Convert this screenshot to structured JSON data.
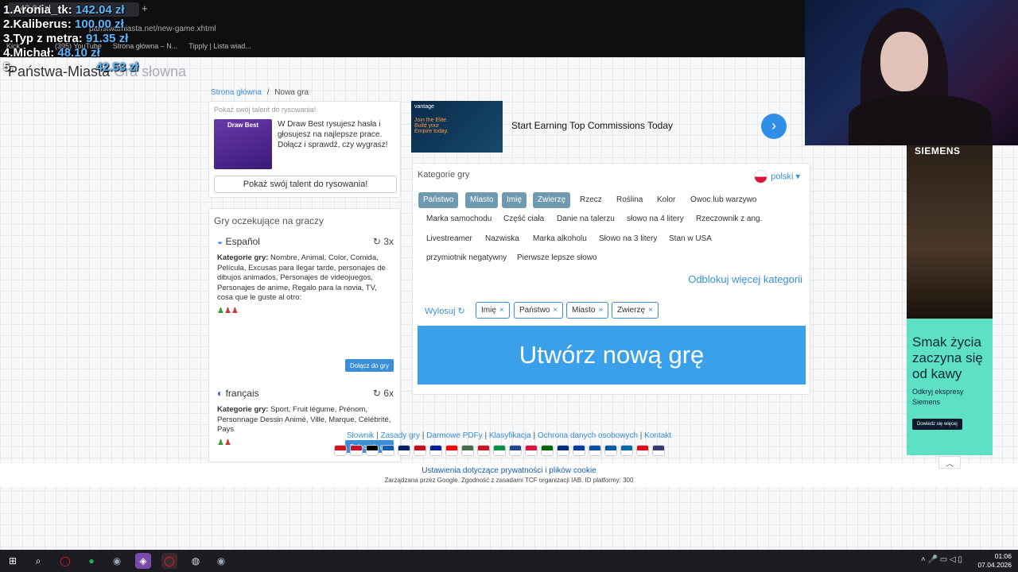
{
  "browser": {
    "tab_title": "...42.04 zł",
    "new_tab": "+",
    "url": "panstwamiasta.net/new-game.xhtml",
    "bookmarks": [
      "Kick",
      "(395) YouTube",
      "Strona główna – N...",
      "Tipply | Lista wiad..."
    ]
  },
  "leaderboard": [
    {
      "rank": "1.",
      "name": "Aronia_tk:",
      "amount": "142.04 zł"
    },
    {
      "rank": "2.",
      "name": "Kaliberus:",
      "amount": "100.00 zł"
    },
    {
      "rank": "3.",
      "name": "Typ z metra:",
      "amount": "91.35 zł"
    },
    {
      "rank": "4.",
      "name": "Michał:",
      "amount": "48.10 zł"
    },
    {
      "rank": "5.",
      "name": "",
      "amount": "42.53 zł"
    }
  ],
  "site": {
    "title": "Państwa-Miasta",
    "subtitle": "Gra słowna"
  },
  "breadcrumb": {
    "home": "Strona główna",
    "separator": "/",
    "current": "Nowa gra"
  },
  "promo": {
    "header": "Pokaż swój talent do rysowania!",
    "image_label": "Draw Best",
    "text": "W Draw Best rysujesz hasła i głosujesz na najlepsze prace. Dołącz i sprawdź, czy wygrasz!",
    "button": "Pokaż swój talent do rysowania!"
  },
  "ad_banner": {
    "image_brand": "vantage",
    "image_text": "Join the Elite. Build your Empire today.",
    "text": "Start Earning Top Commissions Today",
    "arrow": "›"
  },
  "waiting_games": {
    "title": "Gry oczekujące na graczy",
    "categories_label": "Kategorie gry:",
    "join_label": "Dołącz do gry",
    "games": [
      {
        "language": "Español",
        "count": "3x",
        "categories": "Nombre, Animal, Color, Comida, Película, Excusas para llegar tarde, personajes de dibujos animados, Personajes de videojuegos, Personajes de anime, Regalo para la novia, TV, cosa que le guste al otro:",
        "players_green": "♟",
        "players_red": "♟♟"
      },
      {
        "language": "français",
        "count": "6x",
        "categories": "Sport, Fruit légume, Prénom, Personnage Dessin Animé, Ville, Marque, Célébrité, Pays",
        "players_green": "♟",
        "players_red": "♟"
      }
    ]
  },
  "categories": {
    "title": "Kategorie gry",
    "language": "polski",
    "chips": [
      {
        "label": "Państwo",
        "selected": true
      },
      {
        "label": "Miasto",
        "selected": true
      },
      {
        "label": "Imię",
        "selected": true
      },
      {
        "label": "Zwierzę",
        "selected": true
      },
      {
        "label": "Rzecz",
        "selected": false
      },
      {
        "label": "Roślina",
        "selected": false
      },
      {
        "label": "Kolor",
        "selected": false
      },
      {
        "label": "Owoc lub warzywo",
        "selected": false
      },
      {
        "label": "Marka samochodu",
        "selected": false
      },
      {
        "label": "Część ciała",
        "selected": false
      },
      {
        "label": "Danie na talerzu",
        "selected": false
      },
      {
        "label": "słowo na 4 litery",
        "selected": false
      },
      {
        "label": "Rzeczownik z ang.",
        "selected": false
      },
      {
        "label": "Livestreamer",
        "selected": false
      },
      {
        "label": "Nazwiska",
        "selected": false
      },
      {
        "label": "Marka alkoholu",
        "selected": false
      },
      {
        "label": "Słowo na 3 litery",
        "selected": false
      },
      {
        "label": "Stan w USA",
        "selected": false
      },
      {
        "label": "przymiotnik negatywny",
        "selected": false
      },
      {
        "label": "Pierwsze lepsze słowo",
        "selected": false
      }
    ],
    "unlock": "Odblokuj więcej kategorii",
    "randomize": "Wylosuj",
    "selected": [
      "Imię",
      "Państwo",
      "Miasto",
      "Zwierzę"
    ],
    "remove_symbol": "×",
    "create_button": "Utwórz nową grę"
  },
  "footer": {
    "links": [
      "Słownik",
      "Zasady gry",
      "Darmowe PDFy",
      "Klasyfikacja",
      "Ochrona danych osobowych",
      "Kontakt"
    ],
    "flag_colors": [
      "#d7141a",
      "#c8102e",
      "#000000",
      "#0d5eaf",
      "#012169",
      "#c60b1e",
      "#002395",
      "#ff0000",
      "#436f4d",
      "#ce1126",
      "#009246",
      "#21468b",
      "#dc143c",
      "#006600",
      "#002b7f",
      "#0039a6",
      "#0b4ea2",
      "#005da4",
      "#006aa7",
      "#e30a17",
      "#3c3b6e"
    ]
  },
  "cookie": {
    "link": "Ustawienia dotyczące prywatności i plików cookie",
    "note": "Zarządzana przez Google. Zgodność z zasadami TCF organizacji IAB. ID platformy: 300"
  },
  "side_ad": {
    "brand": "SIEMENS",
    "headline": "Smak życia zaczyna się od kawy",
    "body": "Odkryj ekspresy Siemens",
    "button": "Dowiedz się więcej"
  },
  "taskbar": {
    "time": "01:06",
    "date": "07.04.2026"
  }
}
